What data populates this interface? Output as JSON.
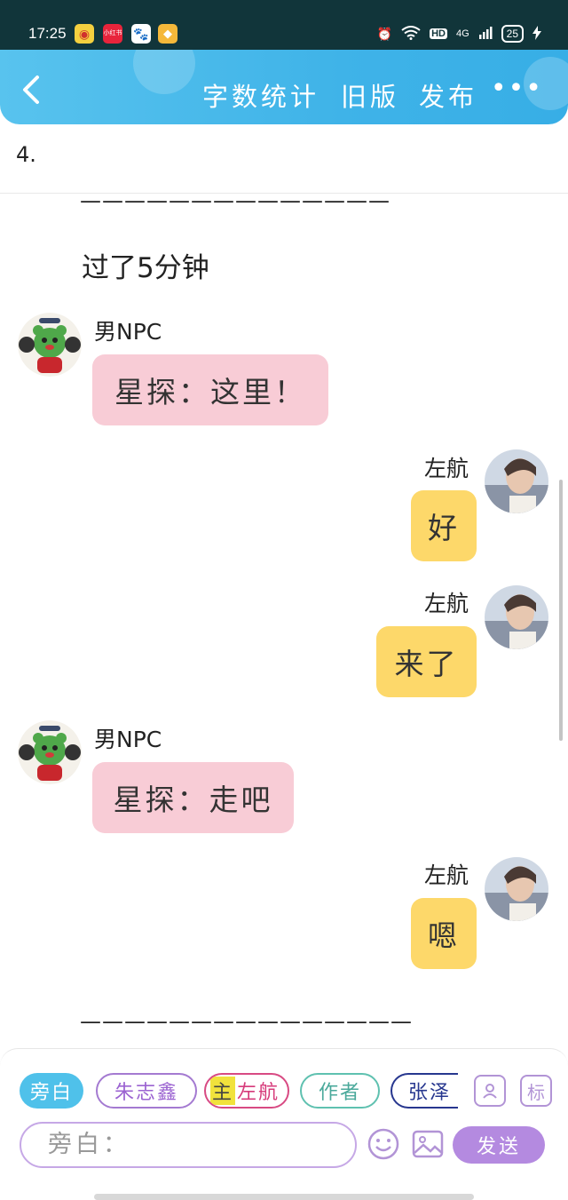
{
  "status": {
    "time": "17:25",
    "apps": [
      "weibo-icon",
      "xiaohongshu-icon",
      "baidu-icon",
      "diamond-app-icon"
    ],
    "xhs_label": "小红书",
    "hd": "HD",
    "network": "4G",
    "battery": "25"
  },
  "header": {
    "word_count": "字数统计",
    "old_version": "旧版",
    "publish": "发布",
    "more": "•••"
  },
  "content": {
    "item_number": "4.",
    "dashes_top": "——————————————",
    "narration": "过了5分钟",
    "dashes_bottom": "———————————————"
  },
  "messages": [
    {
      "side": "left",
      "name": "男NPC",
      "text": "星探：这里！"
    },
    {
      "side": "right",
      "name": "左航",
      "text": "好"
    },
    {
      "side": "right",
      "name": "左航",
      "text": "来了"
    },
    {
      "side": "left",
      "name": "男NPC",
      "text": "星探：走吧"
    },
    {
      "side": "right",
      "name": "左航",
      "text": "嗯"
    }
  ],
  "composer": {
    "chips": {
      "narration": "旁白",
      "zhu": "朱志鑫",
      "main_tag": "主",
      "zuo": "左航",
      "author": "作者",
      "zhang": "张泽"
    },
    "role_icon": "person-card-icon",
    "mark_label": "标",
    "input_value": "旁白：",
    "emoji_icon": "smiley-icon",
    "image_icon": "image-icon",
    "send_label": "发送"
  },
  "colors": {
    "header": "#3fb3e8",
    "pink_bubble": "#f8ccd6",
    "yellow_bubble": "#fdd86a",
    "send": "#b48ae0"
  }
}
